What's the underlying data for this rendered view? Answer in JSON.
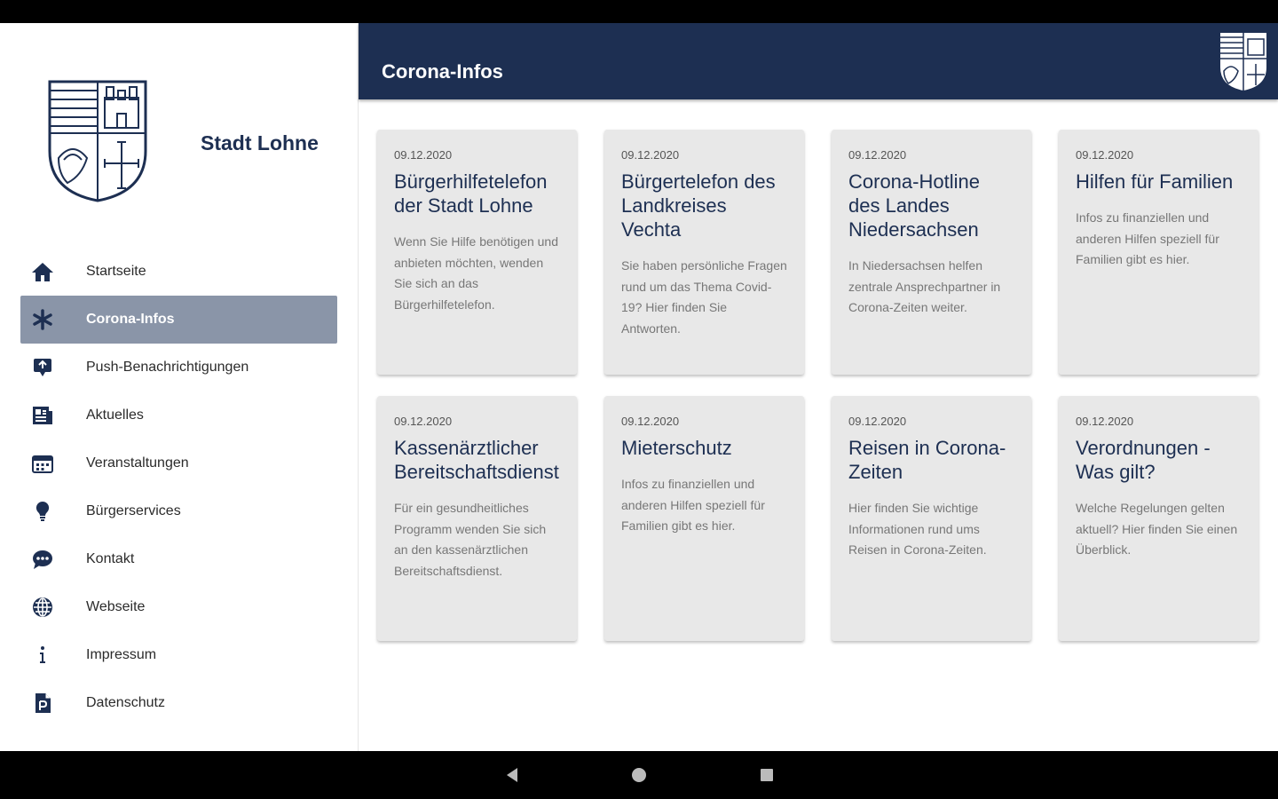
{
  "app": {
    "city_name": "Stadt Lohne",
    "page_title": "Corona-Infos"
  },
  "menu": [
    {
      "label": "Startseite",
      "icon": "home-icon",
      "active": false
    },
    {
      "label": "Corona-Infos",
      "icon": "asterisk-icon",
      "active": true
    },
    {
      "label": "Push-Benachrichtigungen",
      "icon": "push-notification-icon",
      "active": false
    },
    {
      "label": "Aktuelles",
      "icon": "newspaper-icon",
      "active": false
    },
    {
      "label": "Veranstaltungen",
      "icon": "calendar-icon",
      "active": false
    },
    {
      "label": "Bürgerservices",
      "icon": "lightbulb-icon",
      "active": false
    },
    {
      "label": "Kontakt",
      "icon": "chat-icon",
      "active": false
    },
    {
      "label": "Webseite",
      "icon": "globe-icon",
      "active": false
    },
    {
      "label": "Impressum",
      "icon": "info-icon",
      "active": false
    },
    {
      "label": "Datenschutz",
      "icon": "document-icon",
      "active": false
    }
  ],
  "cards": [
    {
      "date": "09.12.2020",
      "title": "Bürgerhilfetelefon der Stadt Lohne",
      "desc": "Wenn Sie Hilfe benötigen und anbieten möchten, wenden Sie sich an das Bürgerhilfetelefon."
    },
    {
      "date": "09.12.2020",
      "title": "Bürgertelefon des Landkreises Vechta",
      "desc": "Sie haben persönliche Fragen rund um das Thema Covid-19? Hier finden Sie Antworten."
    },
    {
      "date": "09.12.2020",
      "title": "Corona-Hotline des Landes Niedersachsen",
      "desc": "In Niedersachsen helfen zentrale Ansprechpartner in Corona-Zeiten weiter."
    },
    {
      "date": "09.12.2020",
      "title": "Hilfen für Familien",
      "desc": "Infos zu finanziellen und anderen Hilfen speziell für Familien gibt es hier."
    },
    {
      "date": "09.12.2020",
      "title": "Kassenärztlicher Bereitschaftsdienst",
      "desc": "Für ein gesundheitliches Programm wenden Sie sich an den kassenärztlichen Bereitschaftsdienst."
    },
    {
      "date": "09.12.2020",
      "title": "Mieterschutz",
      "desc": "Infos zu finanziellen und anderen Hilfen speziell für Familien gibt es hier."
    },
    {
      "date": "09.12.2020",
      "title": "Reisen in Corona-Zeiten",
      "desc": "Hier finden Sie wichtige Informationen rund ums Reisen in Corona-Zeiten."
    },
    {
      "date": "09.12.2020",
      "title": "Verordnungen - Was gilt?",
      "desc": "Welche Regelungen gelten aktuell? Hier finden Sie einen Überblick."
    }
  ],
  "colors": {
    "primary": "#1d2f52",
    "active_item_bg": "#8a95a8",
    "card_bg": "#e8e8e8"
  }
}
